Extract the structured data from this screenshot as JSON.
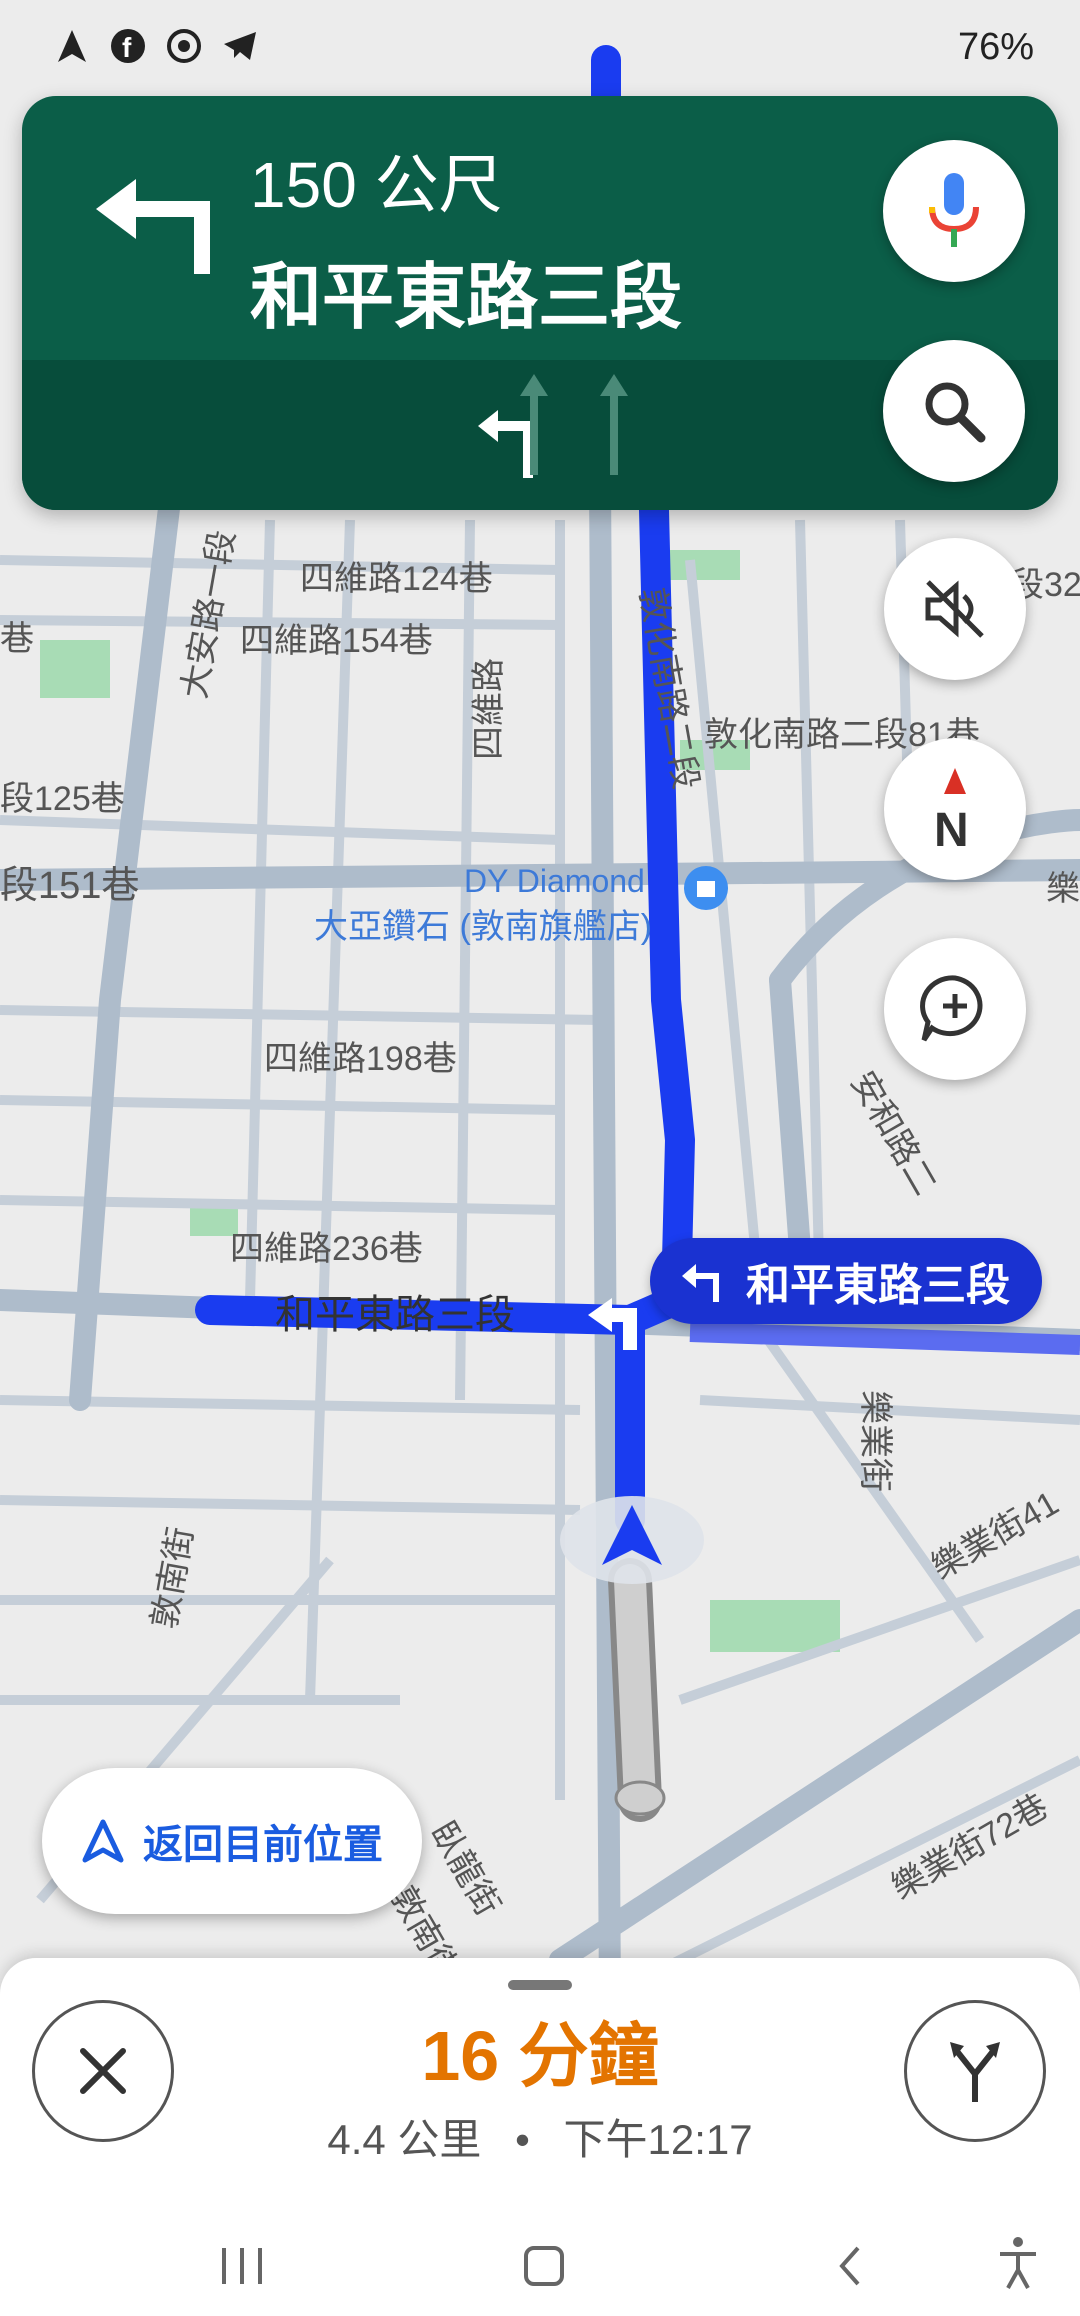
{
  "status_bar": {
    "battery": "76%",
    "icons": [
      "navigation-icon",
      "facebook-icon",
      "sync-icon",
      "telegram-icon"
    ]
  },
  "nav_banner": {
    "distance": "150 公尺",
    "street": "和平東路三段",
    "turn": "turn-left",
    "lanes": [
      "turn-left",
      "straight",
      "straight"
    ]
  },
  "map_labels": {
    "l1": "四維路124巷",
    "l2": "四維路154巷",
    "l3": "大安路一段",
    "l4": "敦化南路二段",
    "l5": "四維路",
    "l6": "敦化南路二段81巷",
    "l7": "段125巷",
    "l8": "段151巷",
    "poi_en": "DY Diamond",
    "poi_zh": "大亞鑽石 (敦南旗艦店)",
    "l9": "四維路198巷",
    "l10": "安和路二",
    "l11": "四維路236巷",
    "l12": "和平東路三段",
    "l13": "敦南街",
    "l14": "樂業街",
    "l15": "樂業街41",
    "l16": "樂業街72巷",
    "l17": "臥龍街",
    "l18": "敦南街",
    "l19": "巷",
    "l20": "段32",
    "l21": "樂"
  },
  "street_chip": "和平東路三段",
  "recenter_label": "返回目前位置",
  "trip": {
    "eta": "16 分鐘",
    "distance": "4.4 公里",
    "separator": "•",
    "arrival": "下午12:17"
  },
  "colors": {
    "banner": "#0b5e48",
    "route": "#1a3cf0",
    "eta": "#e37400",
    "park": "#a8dcb5"
  }
}
